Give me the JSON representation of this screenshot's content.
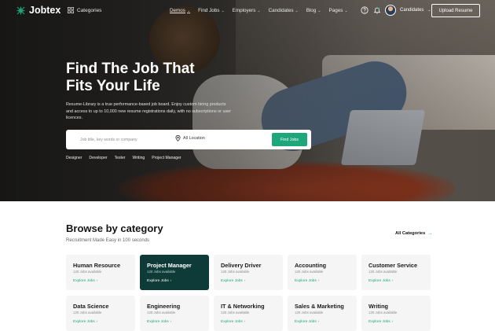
{
  "nav": {
    "logo_text": "Jobtex",
    "categories_label": "Categories",
    "menu": [
      {
        "label": "Demos",
        "active": true
      },
      {
        "label": "Find Jobs",
        "active": false
      },
      {
        "label": "Employers",
        "active": false
      },
      {
        "label": "Candidates",
        "active": false
      },
      {
        "label": "Blog",
        "active": false
      },
      {
        "label": "Pages",
        "active": false
      }
    ],
    "user_label": "Candidates",
    "upload_label": "Upload Resume"
  },
  "hero": {
    "title_line1": "Find The Job That",
    "title_line2": "Fits Your Life",
    "description": "Resume-Library is a true performance-based job board. Enjoy custom hiring products and access to up to 10,000 new resume registrations daily, with no subscriptions or user licences.",
    "search_placeholder": "Job title, key words or company",
    "location_label": "All Location",
    "find_label": "Find Jobs",
    "tags": [
      "Designer",
      "Developer",
      "Tester",
      "Writing",
      "Project Manager"
    ]
  },
  "browse": {
    "title": "Browse by category",
    "subtitle": "Recruitment Made Easy in 100 seconds",
    "all_label": "All Categories",
    "cards": [
      {
        "title": "Human Resource",
        "count": "120 Jobs available",
        "link": "Explore Jobs",
        "active": false
      },
      {
        "title": "Project Manager",
        "count": "120 Jobs available",
        "link": "Explore Jobs",
        "active": true
      },
      {
        "title": "Delivery Driver",
        "count": "120 Jobs available",
        "link": "Explore Jobs",
        "active": false
      },
      {
        "title": "Accounting",
        "count": "120 Jobs available",
        "link": "Explore Jobs",
        "active": false
      },
      {
        "title": "Customer Service",
        "count": "120 Jobs available",
        "link": "Explore Jobs",
        "active": false
      },
      {
        "title": "Data Science",
        "count": "120 Jobs available",
        "link": "Explore Jobs",
        "active": false
      },
      {
        "title": "Engineering",
        "count": "120 Jobs available",
        "link": "Explore Jobs",
        "active": false
      },
      {
        "title": "IT & Networking",
        "count": "120 Jobs available",
        "link": "Explore Jobs",
        "active": false
      },
      {
        "title": "Sales & Marketing",
        "count": "120 Jobs available",
        "link": "Explore Jobs",
        "active": false
      },
      {
        "title": "Writing",
        "count": "120 Jobs available",
        "link": "Explore Jobs",
        "active": false
      }
    ]
  },
  "colors": {
    "accent": "#1fa67a",
    "active_card": "#0e3b38"
  },
  "icons": [
    "logo-star-icon",
    "grid-icon",
    "help-icon",
    "bell-icon",
    "location-pin-icon",
    "arrow-right-icon"
  ]
}
